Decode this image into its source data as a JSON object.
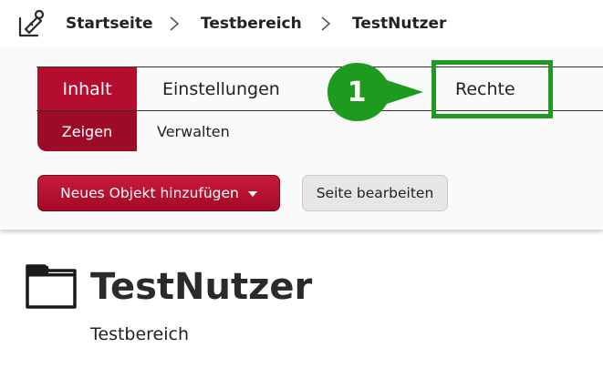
{
  "breadcrumb": {
    "items": [
      "Startseite",
      "Testbereich",
      "TestNutzer"
    ]
  },
  "tabs": {
    "items": [
      "Inhalt",
      "Einstellungen",
      "Rechte"
    ],
    "active": "Inhalt"
  },
  "subtabs": {
    "items": [
      "Zeigen",
      "Verwalten"
    ],
    "active": "Zeigen"
  },
  "actions": {
    "add_object": "Neues Objekt hinzufügen",
    "edit_page": "Seite bearbeiten"
  },
  "callout": {
    "number": "1",
    "target": "Rechte"
  },
  "page": {
    "title": "TestNutzer",
    "subtitle": "Testbereich"
  },
  "colors": {
    "accent": "#b40d2e",
    "callout_green": "#1e9a1e"
  },
  "icons": [
    "home-icon",
    "chevron-right-icon",
    "folder-icon",
    "caret-down-icon"
  ]
}
